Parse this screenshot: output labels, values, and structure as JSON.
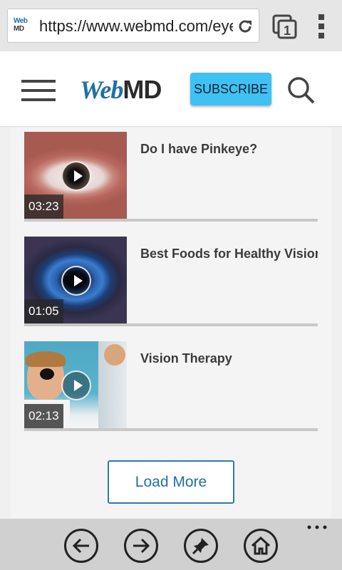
{
  "browser": {
    "url": "https://www.webmd.com/eye",
    "favicon_top": "Web",
    "favicon_bottom": "MD",
    "tab_count": "1"
  },
  "header": {
    "logo_web": "Web",
    "logo_md": "MD",
    "subscribe_label": "SUBSCRIBE"
  },
  "videos": [
    {
      "title": "Do I have Pinkeye?",
      "duration": "03:23"
    },
    {
      "title": "Best Foods for Healthy Vision",
      "duration": "01:05"
    },
    {
      "title": "Vision Therapy",
      "duration": "02:13"
    }
  ],
  "load_more_label": "Load More",
  "colors": {
    "accent": "#3fc1f3",
    "brand": "#1f6fa6"
  }
}
